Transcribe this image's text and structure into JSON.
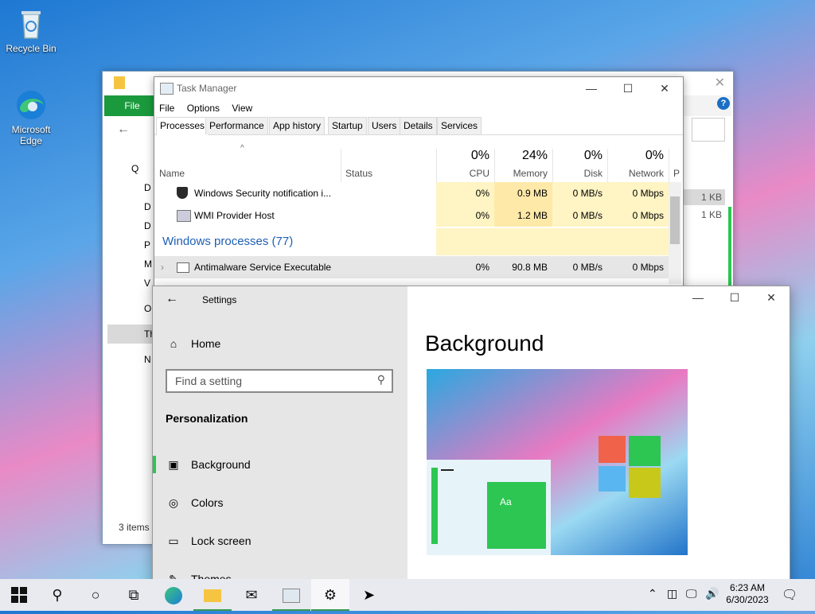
{
  "desktop": {
    "icons": [
      {
        "label": "Recycle Bin",
        "icon": "recycle-bin-icon"
      },
      {
        "label": "Microsoft Edge",
        "icon": "edge-icon"
      }
    ]
  },
  "explorer": {
    "file_tab": "File",
    "status": "3 items",
    "nav_items": [
      "Q",
      "D",
      "D",
      "D",
      "P",
      "M",
      "V",
      "O",
      "Th",
      "N"
    ],
    "sizes": [
      "1 KB",
      "1 KB"
    ]
  },
  "task_manager": {
    "title": "Task Manager",
    "menu": [
      "File",
      "Options",
      "View"
    ],
    "tabs": [
      "Processes",
      "Performance",
      "App history",
      "Startup",
      "Users",
      "Details",
      "Services"
    ],
    "columns": {
      "name": "Name",
      "status": "Status",
      "cpu": {
        "pct": "0%",
        "label": "CPU"
      },
      "memory": {
        "pct": "24%",
        "label": "Memory"
      },
      "disk": {
        "pct": "0%",
        "label": "Disk"
      },
      "network": {
        "pct": "0%",
        "label": "Network"
      },
      "power": "P"
    },
    "rows": [
      {
        "name": "Windows Security notification i...",
        "cpu": "0%",
        "memory": "0.9 MB",
        "disk": "0 MB/s",
        "network": "0 Mbps"
      },
      {
        "name": "WMI Provider Host",
        "cpu": "0%",
        "memory": "1.2 MB",
        "disk": "0 MB/s",
        "network": "0 Mbps"
      }
    ],
    "group_header": "Windows processes (77)",
    "group_rows": [
      {
        "name": "Antimalware Service Executable",
        "cpu": "0%",
        "memory": "90.8 MB",
        "disk": "0 MB/s",
        "network": "0 Mbps"
      }
    ]
  },
  "settings": {
    "title": "Settings",
    "home": "Home",
    "search_placeholder": "Find a setting",
    "section": "Personalization",
    "nav": [
      {
        "label": "Background",
        "icon": "picture-icon",
        "active": true
      },
      {
        "label": "Colors",
        "icon": "palette-icon"
      },
      {
        "label": "Lock screen",
        "icon": "lock-screen-icon"
      },
      {
        "label": "Themes",
        "icon": "themes-icon"
      }
    ],
    "page_title": "Background",
    "preview_tile_text": "Aa"
  },
  "taskbar": {
    "time": "6:23 AM",
    "date": "6/30/2023"
  },
  "colors": {
    "accent_green": "#2dc653",
    "tm_highlight": "#fff4c4",
    "group_blue": "#1e5fb4"
  }
}
